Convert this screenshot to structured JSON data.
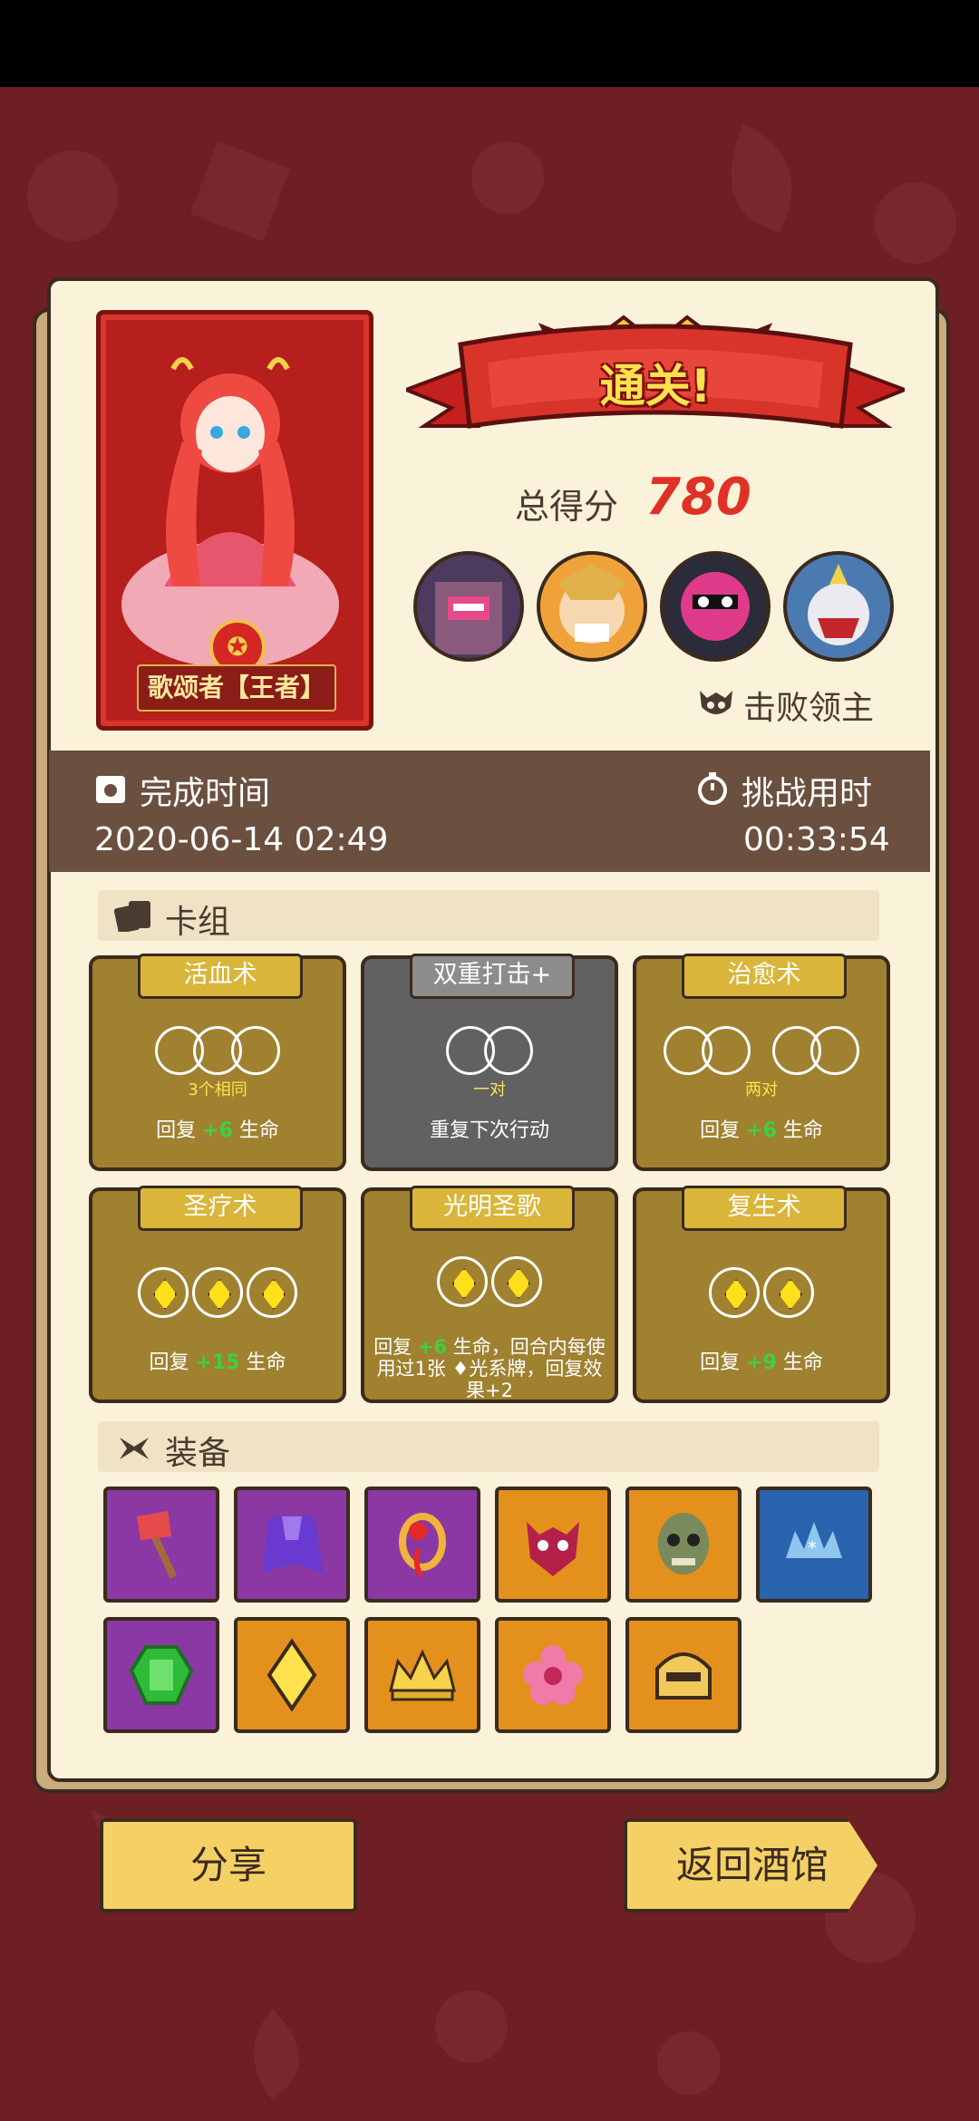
{
  "hero": {
    "name": "歌颂者【王者】"
  },
  "result": {
    "title": "通关!",
    "score_label": "总得分",
    "score_value": "780",
    "defeated_label": "击败领主"
  },
  "bosses": [
    "boss-1",
    "boss-2",
    "boss-3",
    "boss-4"
  ],
  "times": {
    "finish_label": "完成时间",
    "finish_value": "2020-06-14 02:49",
    "duration_label": "挑战用时",
    "duration_value": "00:33:54"
  },
  "deck": {
    "title": "卡组",
    "cards": [
      {
        "name": "活血术",
        "sub": "3个相同",
        "effect_pre": "回复 ",
        "plus": "+",
        "amount": "6",
        "effect_post": " 生命"
      },
      {
        "name": "双重打击+",
        "sub": "一对",
        "effect": "重复下次行动"
      },
      {
        "name": "治愈术",
        "sub": "两对",
        "effect_pre": "回复 ",
        "plus": "+",
        "amount": "6",
        "effect_post": " 生命"
      },
      {
        "name": "圣疗术",
        "effect_pre": "回复 ",
        "plus": "+",
        "amount": "15",
        "effect_post": " 生命"
      },
      {
        "name": "光明圣歌",
        "effect_pre": "回复 ",
        "plus": "+",
        "amount": "6",
        "effect_post": " 生命，回合内每使用过1张 ♦光系牌，回复效果+2"
      },
      {
        "name": "复生术",
        "effect_pre": "回复 ",
        "plus": "+",
        "amount": "9",
        "effect_post": " 生命"
      }
    ]
  },
  "equipment": {
    "title": "装备",
    "items": [
      "axe",
      "cloak",
      "ring",
      "demon-mask",
      "skull-mask",
      "crown-blue",
      "emerald",
      "yellow-gem",
      "gold-crown",
      "pink-flower",
      "helmet"
    ]
  },
  "buttons": {
    "share": "分享",
    "back": "返回酒馆"
  }
}
